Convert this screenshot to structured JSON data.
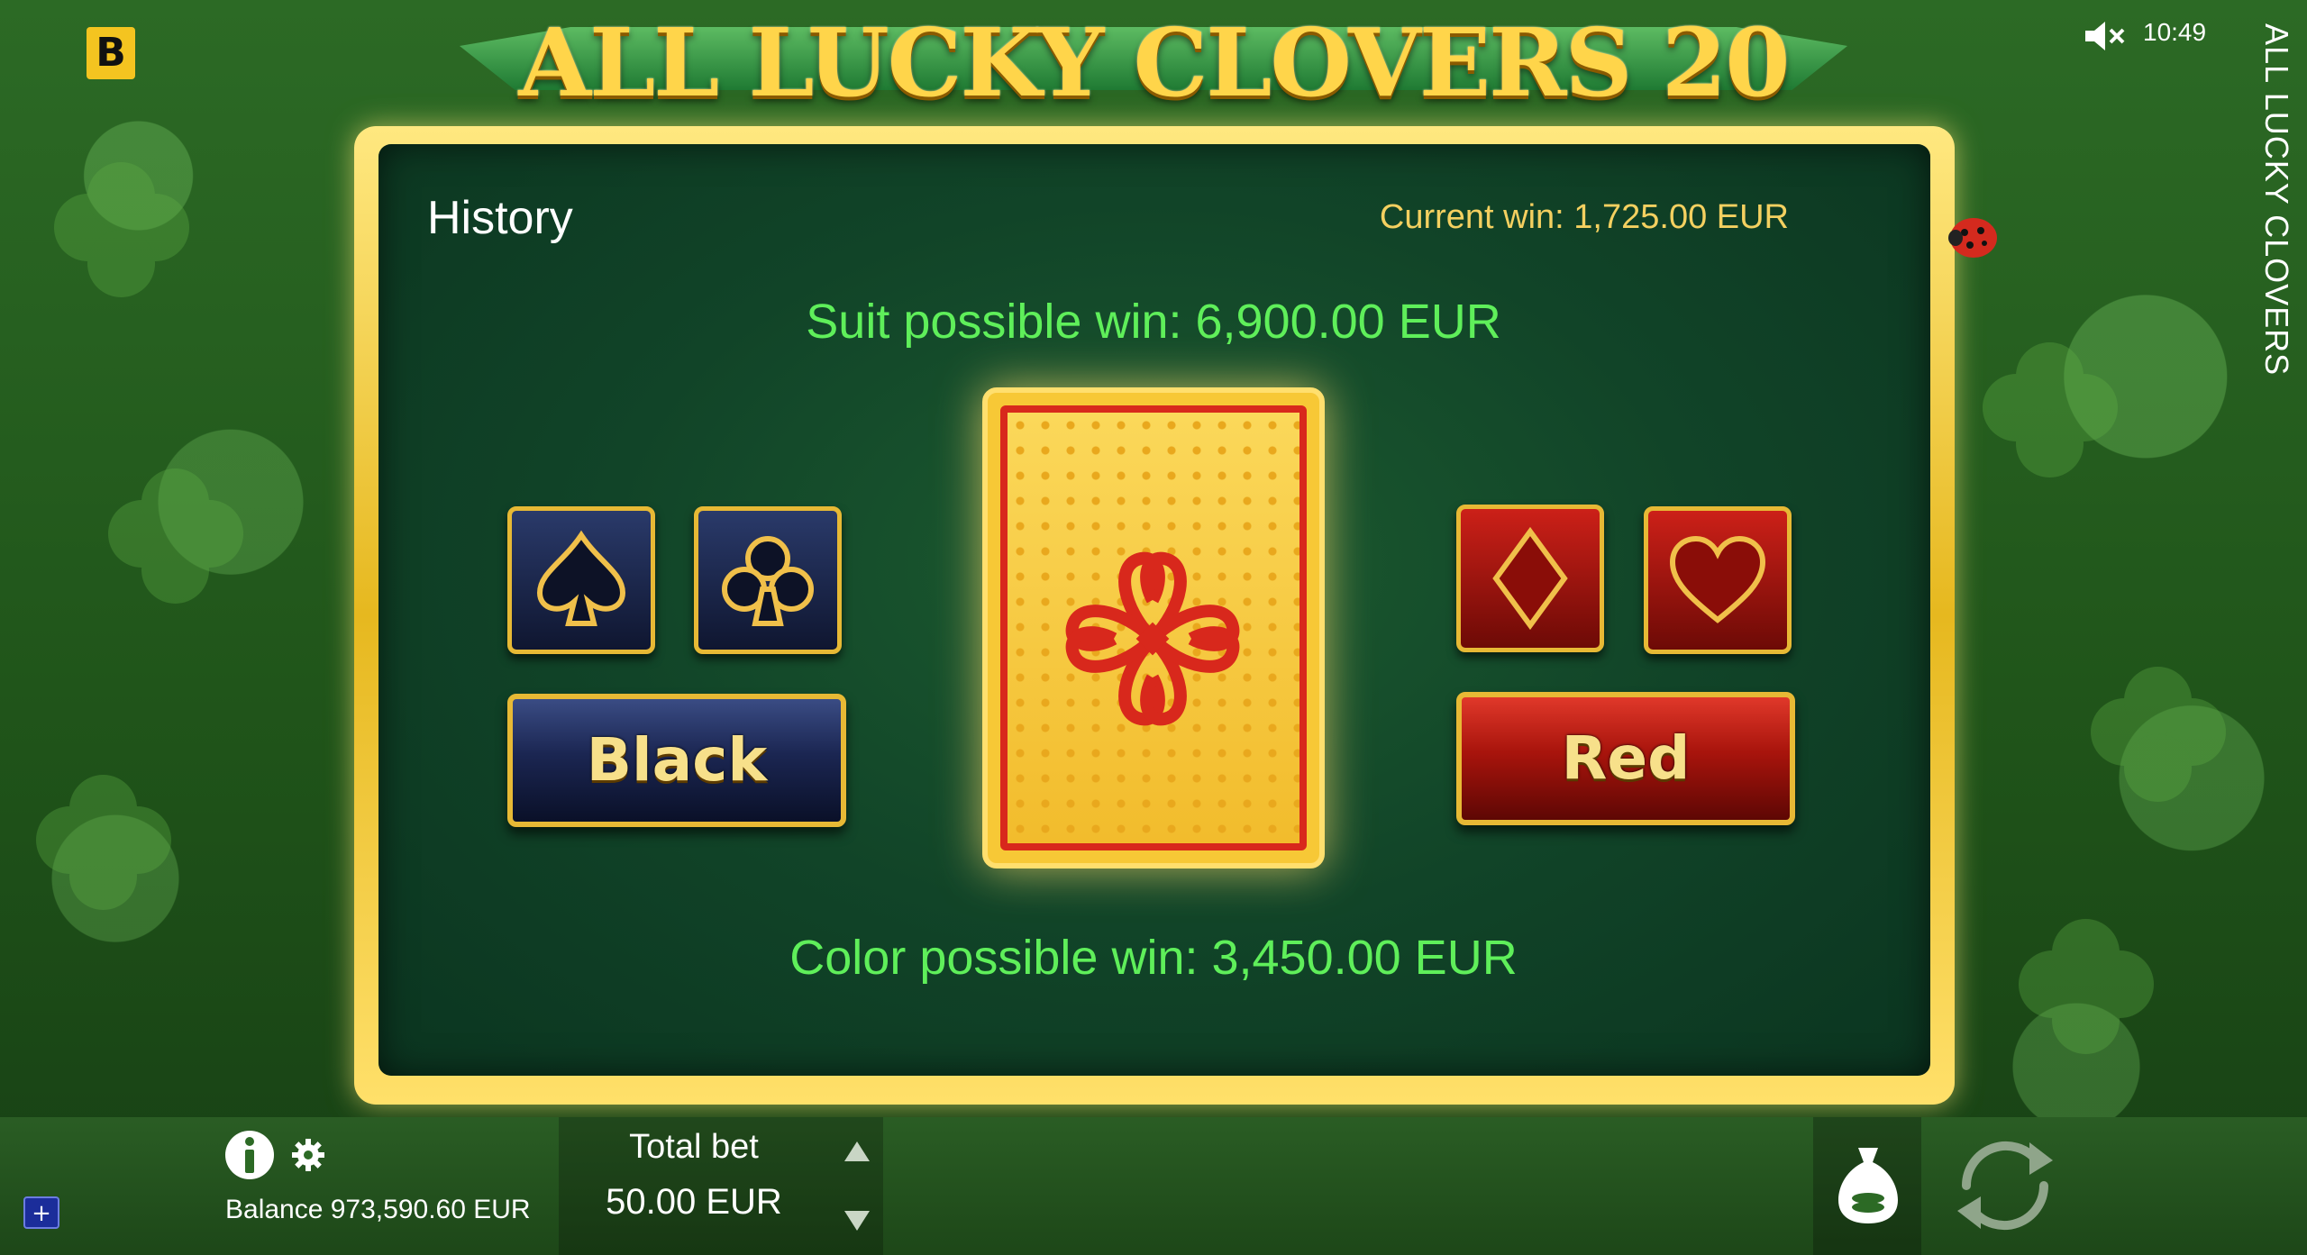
{
  "game": {
    "brand_logo": "B",
    "title": "ALL LUCKY CLOVERS 20",
    "side_title": "ALL LUCKY CLOVERS",
    "clock": "10:49"
  },
  "gamble": {
    "history_label": "History",
    "current_win": "Current win: 1,725.00 EUR",
    "suit_possible_win": "Suit possible win: 6,900.00 EUR",
    "color_possible_win": "Color possible win: 3,450.00 EUR",
    "black_label": "Black",
    "red_label": "Red",
    "suits": [
      "spade",
      "club",
      "diamond",
      "heart"
    ]
  },
  "footer": {
    "balance": "Balance 973,590.60 EUR",
    "total_bet_label": "Total bet",
    "total_bet_value": "50.00 EUR",
    "plus_label": "+"
  },
  "colors": {
    "gold": "#e7b935",
    "win_green": "#5fef5a",
    "current_win_gold": "#f4d060",
    "black_button": "#1b2652",
    "red_button": "#a8140c"
  }
}
